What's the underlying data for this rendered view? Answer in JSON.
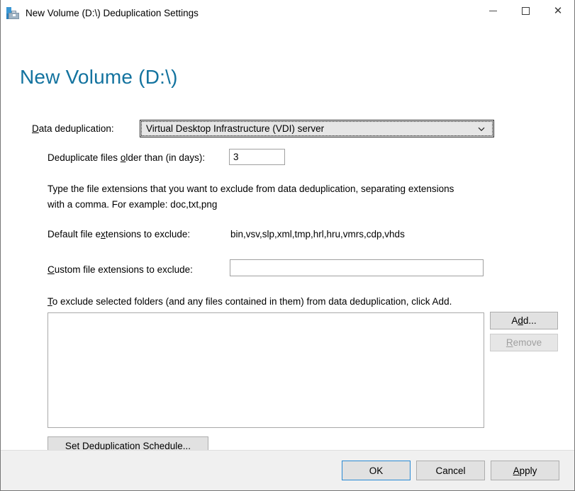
{
  "window": {
    "title": "New Volume (D:\\) Deduplication Settings",
    "icon": "server-toolbox-icon",
    "controls": {
      "minimize": "minimize-icon",
      "maximize": "maximize-icon",
      "close": "close-icon"
    }
  },
  "page": {
    "heading": "New Volume (D:\\)",
    "heading_color": "#13739f"
  },
  "form": {
    "dedup_label_pre": "",
    "dedup_label_accel": "D",
    "dedup_label_post": "ata deduplication:",
    "dedup_value": "Virtual Desktop Infrastructure (VDI) server",
    "dedup_arrow_icon": "chevron-down-icon",
    "age_label_pre": "Deduplicate files ",
    "age_label_accel": "o",
    "age_label_post": "lder than (in days):",
    "age_value": "3",
    "extensions_description": "Type the file extensions that you want to exclude from data deduplication, separating extensions with a comma. For example: doc,txt,png",
    "default_ext_label_pre": "Default file e",
    "default_ext_label_accel": "x",
    "default_ext_label_post": "tensions to exclude:",
    "default_ext_value": "bin,vsv,slp,xml,tmp,hrl,hru,vmrs,cdp,vhds",
    "custom_ext_label_pre": "",
    "custom_ext_label_accel": "C",
    "custom_ext_label_post": "ustom file extensions to exclude:",
    "custom_ext_value": "",
    "custom_ext_placeholder": "",
    "folders_desc_pre": "",
    "folders_desc_accel": "T",
    "folders_desc_post": "o exclude selected folders (and any files contained in them) from data deduplication, click Add.",
    "excluded_folders": []
  },
  "buttons": {
    "add_pre": "A",
    "add_accel": "d",
    "add_post": "d...",
    "remove_pre": "",
    "remove_accel": "R",
    "remove_post": "emove",
    "remove_enabled": false,
    "schedule_pre": "",
    "schedule_accel": "S",
    "schedule_post": "et Deduplication Schedule...",
    "ok": "OK",
    "cancel": "Cancel",
    "apply_pre": "",
    "apply_accel": "A",
    "apply_post": "pply"
  },
  "colors": {
    "accent": "#13739f",
    "default_button_border": "#2a8ad4",
    "footer_bg": "#f0f0f0",
    "body_bg": "#ffffff"
  }
}
